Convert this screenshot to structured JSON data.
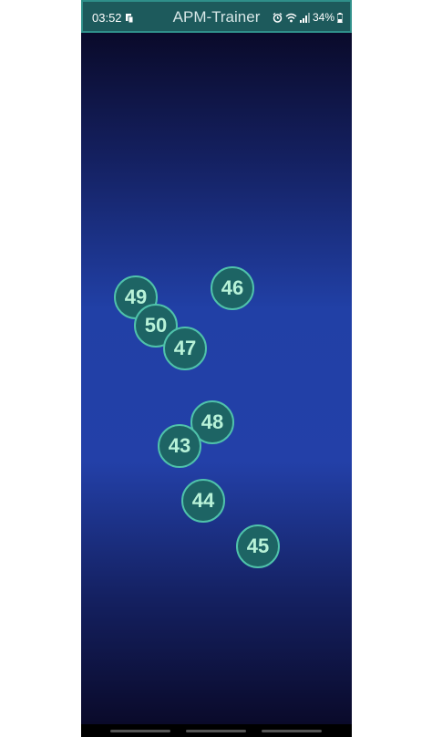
{
  "status_bar": {
    "time": "03:52",
    "app_title": "APM-Trainer",
    "battery": "34%"
  },
  "targets": [
    {
      "label": "49"
    },
    {
      "label": "46"
    },
    {
      "label": "50"
    },
    {
      "label": "47"
    },
    {
      "label": "48"
    },
    {
      "label": "43"
    },
    {
      "label": "44"
    },
    {
      "label": "45"
    }
  ]
}
